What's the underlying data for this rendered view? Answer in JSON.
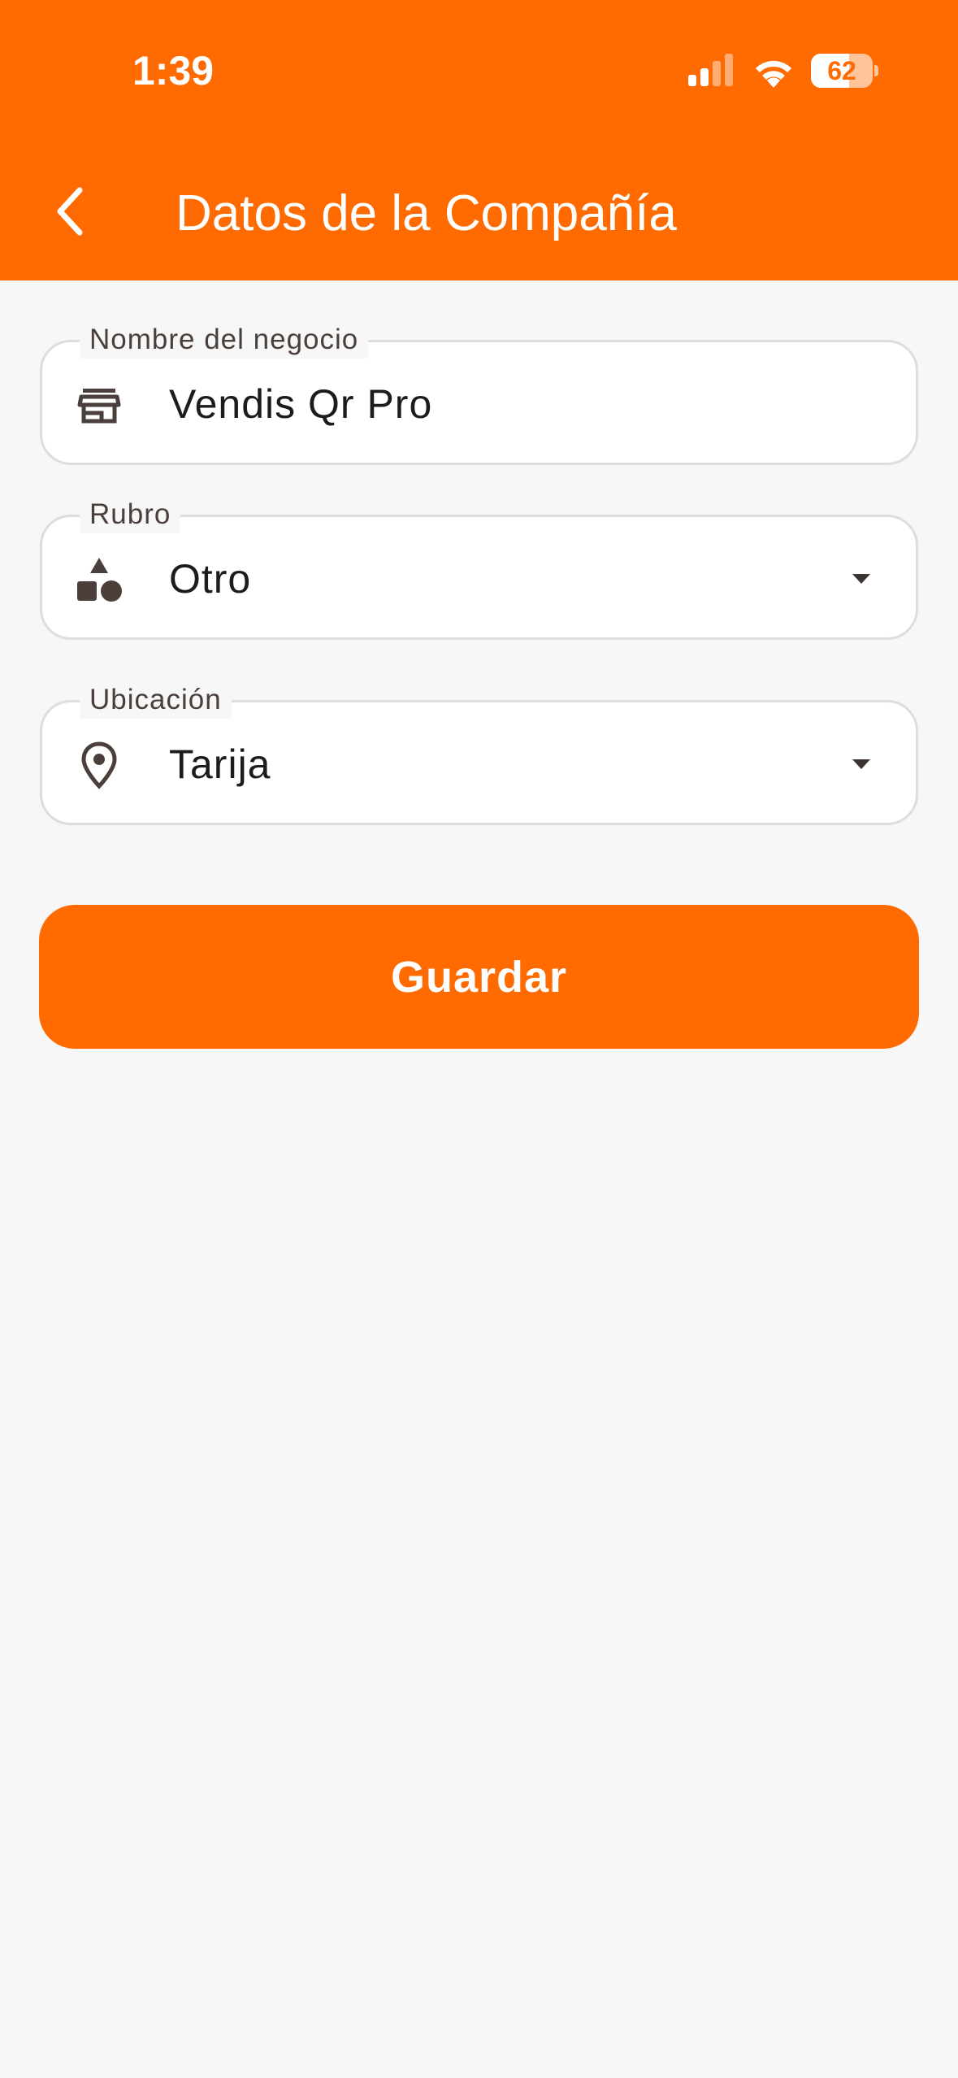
{
  "status_bar": {
    "time": "1:39",
    "battery": "62",
    "battery_level": 0.62
  },
  "header": {
    "title": "Datos de la Compañía",
    "back_icon": "chevron-left-icon"
  },
  "form": {
    "business_name": {
      "label": "Nombre del negocio",
      "value": "Vendis Qr Pro",
      "icon": "store-icon"
    },
    "category": {
      "label": "Rubro",
      "value": "Otro",
      "icon": "shapes-icon"
    },
    "location": {
      "label": "Ubicación",
      "value": "Tarija",
      "icon": "location-pin-icon"
    }
  },
  "save_label": "Guardar",
  "colors": {
    "accent": "#ff6b00",
    "background": "#f7f7f7",
    "text": "#1d1b1b",
    "icon": "#4a3f3a"
  }
}
